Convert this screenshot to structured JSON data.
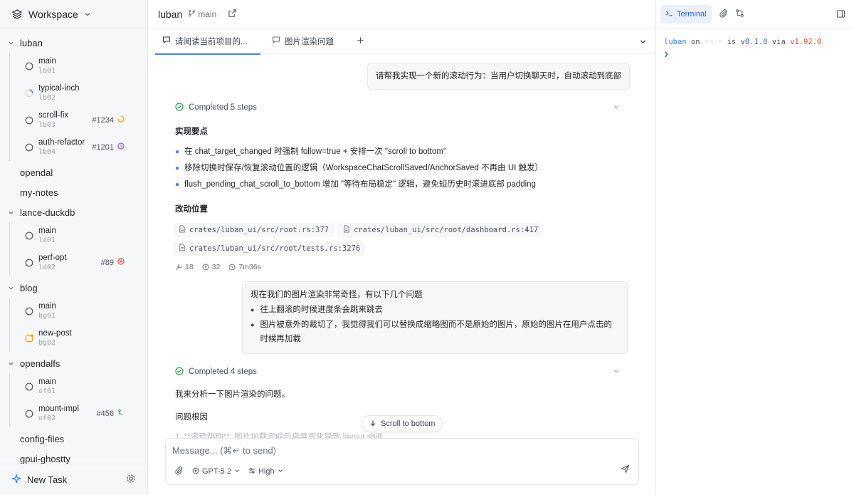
{
  "sidebar": {
    "workspace": "Workspace",
    "groups": [
      {
        "name": "luban",
        "branches": [
          {
            "name": "main",
            "code": "lb01"
          },
          {
            "name": "typical-inch",
            "code": "lb02"
          },
          {
            "name": "scroll-fix",
            "code": "lb03",
            "pr": "#1234"
          },
          {
            "name": "auth-refactor",
            "code": "lb04",
            "pr": "#1201"
          }
        ]
      },
      {
        "name": "opendal"
      },
      {
        "name": "my-notes"
      },
      {
        "name": "lance-duckdb",
        "branches": [
          {
            "name": "main",
            "code": "ld01"
          },
          {
            "name": "perf-opt",
            "code": "ld02",
            "pr": "#89"
          }
        ]
      },
      {
        "name": "blog",
        "branches": [
          {
            "name": "main",
            "code": "bg01"
          },
          {
            "name": "new-post",
            "code": "bg02"
          }
        ]
      },
      {
        "name": "opendalfs",
        "branches": [
          {
            "name": "main",
            "code": "of01"
          },
          {
            "name": "mount-impl",
            "code": "of02",
            "pr": "#456"
          }
        ]
      },
      {
        "name": "config-files"
      },
      {
        "name": "gpui-ghostty"
      }
    ],
    "new_task": "New Task"
  },
  "topbar": {
    "project": "luban",
    "branch": "main"
  },
  "tabs": [
    {
      "label": "请阅读当前项目的..."
    },
    {
      "label": "图片渲染问题"
    }
  ],
  "chat": {
    "user_msg_1": "请帮我实现一个新的滚动行为：当用户切换聊天时，自动滚动到底部",
    "steps_1": "Completed 5 steps",
    "section_1": "实现要点",
    "bullets_1": [
      "在 chat_target_changed 时强制 follow=true + 安排一次 \"scroll to bottom\"",
      "移除切换时保存/恢复滚动位置的逻辑（WorkspaceChatScrollSaved/AnchorSaved 不再由 UI 触发）",
      "flush_pending_chat_scroll_to_bottom 增加 \"等待布局稳定\" 逻辑，避免短历史时滚进底部 padding"
    ],
    "section_2": "改动位置",
    "files": [
      "crates/luban_ui/src/root.rs:377",
      "crates/luban_ui/src/root/dashboard.rs:417",
      "crates/luban_ui/src/root/tests.rs:3276"
    ],
    "stats": {
      "tools": "18",
      "tokens": "32",
      "duration": "7m36s"
    },
    "user_msg_2": {
      "intro": "现在我们的图片渲染非常奇怪，有以下几个问题",
      "items": [
        "往上翻滚的时候进度条会跳来跳去",
        "图片被意外的裁切了，我觉得我们可以替换成缩略图而不是原始的图片，原始的图片在用户点击的时候再加载"
      ]
    },
    "steps_2": "Completed 4 steps",
    "para_1": "我来分析一下图片渲染的问题。",
    "para_2": "问题根因",
    "faded": "1. **滚动跳动**: 图片加载完成后高度变化导致 layout shift",
    "scroll_to_bottom": "Scroll to bottom"
  },
  "composer": {
    "placeholder": "Message... (⌘↵ to send)",
    "model": "GPT-5.2",
    "effort": "High"
  },
  "terminal": {
    "tab_label": "Terminal",
    "line": {
      "dir": "luban",
      "on": "on",
      "hidden": "main",
      "is": "is",
      "version": "v0.1.0",
      "via": "via",
      "rust": "v1.92.0"
    },
    "prompt": "❯"
  },
  "colors": {
    "accent": "#3b82f6",
    "success": "#22a35a",
    "warning": "#f59e0b",
    "danger": "#ef4444",
    "purple": "#8b5cf6"
  }
}
